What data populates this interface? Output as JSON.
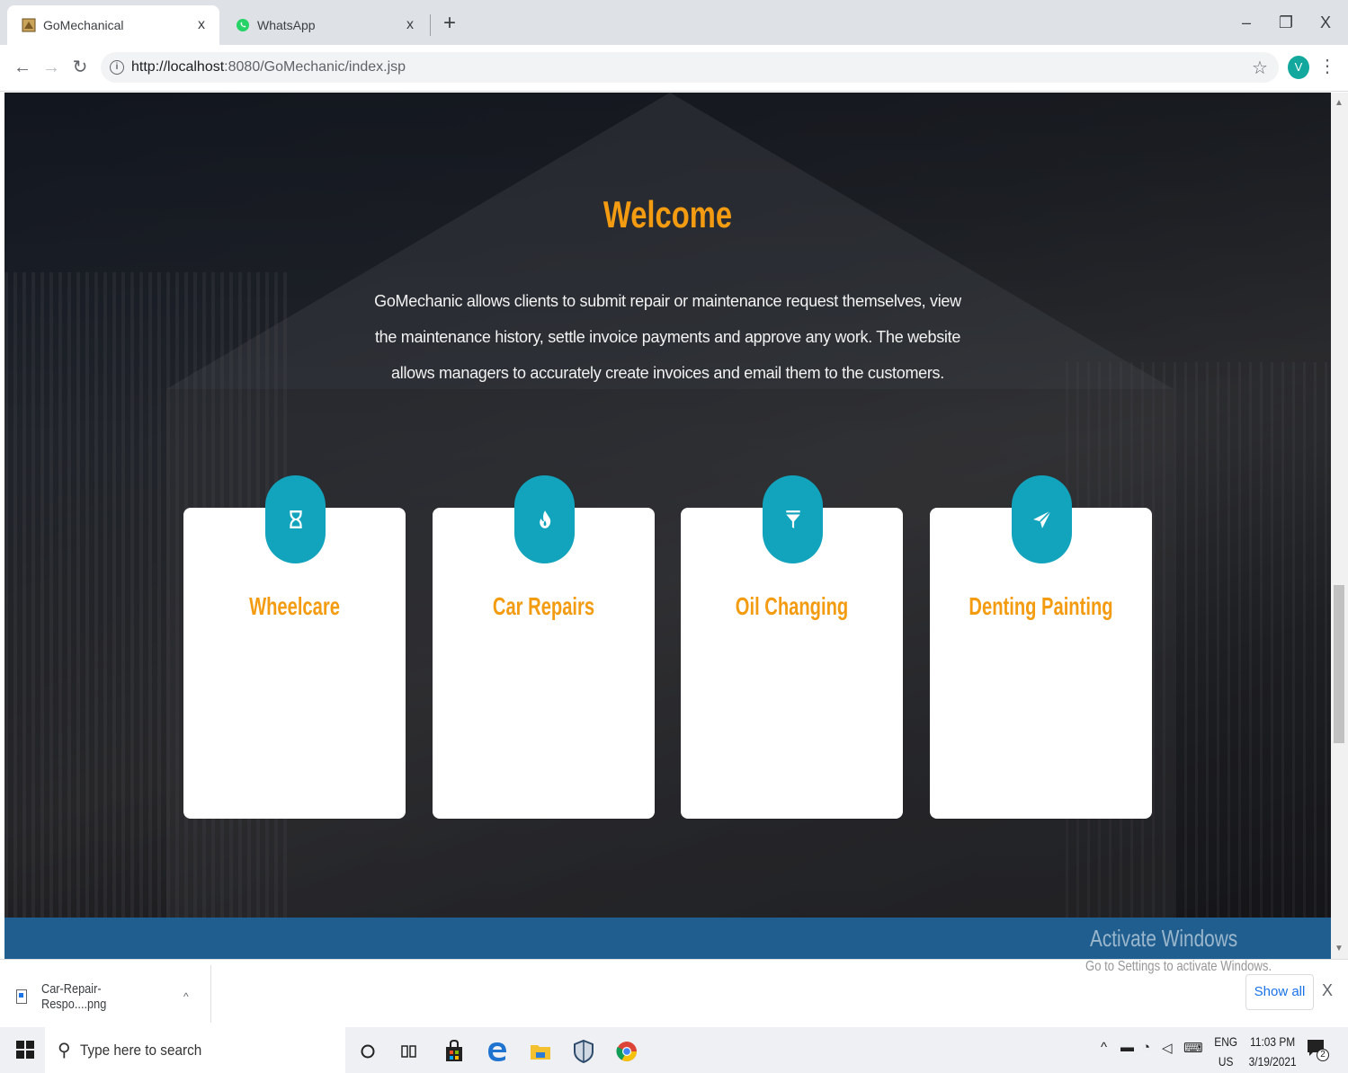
{
  "browser": {
    "tabs": [
      {
        "title": "GoMechanical",
        "active": true,
        "close": "x"
      },
      {
        "title": "WhatsApp",
        "active": false,
        "close": "x"
      }
    ],
    "new_tab": "+",
    "window_controls": {
      "minimize": "–",
      "maximize": "❐",
      "close": "X"
    },
    "url_host": "http://localhost",
    "url_rest": ":8080/GoMechanic/index.jsp",
    "profile_initial": "V"
  },
  "page": {
    "heading": "Welcome",
    "intro": "GoMechanic allows clients to submit repair or maintenance request themselves, view the maintenance history, settle invoice payments and approve any work. The website allows managers to accurately create invoices and email them to the customers.",
    "accent_color": "#f39c12",
    "badge_color": "#12a4bd",
    "services": [
      {
        "title": "Wheelcare",
        "icon": "hourglass-icon"
      },
      {
        "title": "Car Repairs",
        "icon": "flame-icon"
      },
      {
        "title": "Oil Changing",
        "icon": "funnel-icon"
      },
      {
        "title": "Denting Painting",
        "icon": "paper-plane-icon"
      }
    ]
  },
  "watermark": {
    "line1": "Activate Windows",
    "line2": "Go to Settings to activate Windows."
  },
  "downloads": {
    "file_name": "Car-Repair-Respo....png",
    "show_all": "Show all",
    "close": "X"
  },
  "taskbar": {
    "search_placeholder": "Type here to search",
    "lang_top": "ENG",
    "lang_bottom": "US",
    "time": "11:03 PM",
    "date": "3/19/2021",
    "notification_count": "2"
  }
}
